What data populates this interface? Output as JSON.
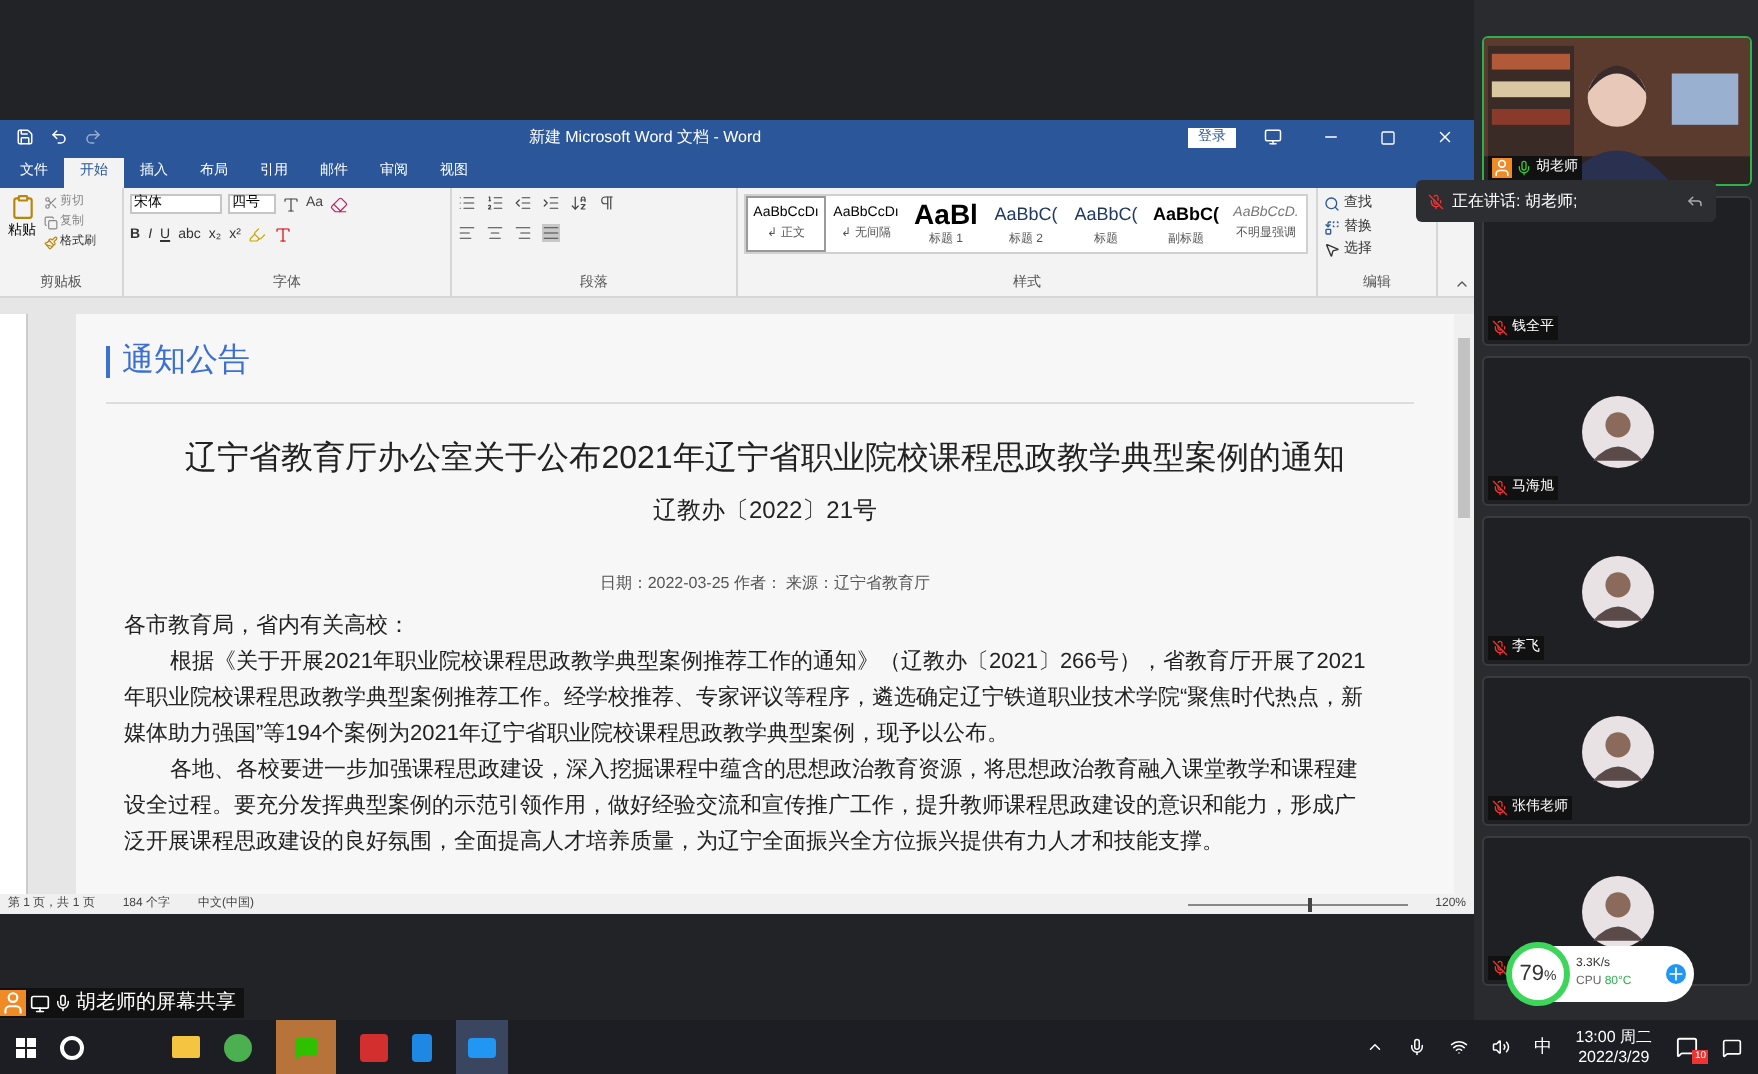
{
  "word": {
    "title": "新建 Microsoft Word 文档 - Word",
    "login": "登录",
    "tabs": [
      {
        "label": "文件",
        "selected": false
      },
      {
        "label": "开始",
        "selected": true
      },
      {
        "label": "插入",
        "selected": false
      },
      {
        "label": "布局",
        "selected": false
      },
      {
        "label": "引用",
        "selected": false
      },
      {
        "label": "邮件",
        "selected": false
      },
      {
        "label": "审阅",
        "selected": false
      },
      {
        "label": "视图",
        "selected": false
      }
    ],
    "clipboard": {
      "paste": "粘贴",
      "cut": "剪切",
      "copy": "复制",
      "format_painter": "格式刷",
      "label": "剪贴板"
    },
    "font": {
      "name": "宋体",
      "size": "四号",
      "change_case": "Aa",
      "buttons": [
        "B",
        "I",
        "U",
        "abc",
        "x₂",
        "x²"
      ],
      "label": "字体"
    },
    "paragraph": {
      "label": "段落"
    },
    "styles": {
      "label": "样式",
      "items": [
        {
          "preview": "AaBbCcDı",
          "name": "↲ 正文",
          "kind": "normal",
          "selected": true
        },
        {
          "preview": "AaBbCcDı",
          "name": "↲ 无间隔",
          "kind": "normal",
          "selected": false
        },
        {
          "preview": "AaBl",
          "name": "标题 1",
          "kind": "heading",
          "selected": false
        },
        {
          "preview": "AaBbC(",
          "name": "标题 2",
          "kind": "subheading",
          "selected": false
        },
        {
          "preview": "AaBbC(",
          "name": "标题",
          "kind": "subheading",
          "selected": false
        },
        {
          "preview": "AaBbC(",
          "name": "副标题",
          "kind": "bold",
          "selected": false
        },
        {
          "preview": "AaBbCcD.",
          "name": "不明显强调",
          "kind": "emphasis",
          "selected": false
        }
      ]
    },
    "editing": {
      "label": "编辑",
      "find": "查找",
      "replace": "替换",
      "select": "选择"
    },
    "document": {
      "section": "通知公告",
      "title": "辽宁省教育厅办公室关于公布2021年辽宁省职业院校课程思政教学典型案例的通知",
      "number": "辽教办〔2022〕21号",
      "meta": "日期：2022-03-25 作者： 来源：辽宁省教育厅",
      "greeting": "各市教育局，省内有关高校：",
      "paragraphs": [
        "根据《关于开展2021年职业院校课程思政教学典型案例推荐工作的通知》（辽教办〔2021〕266号），省教育厅开展了2021年职业院校课程思政教学典型案例推荐工作。经学校推荐、专家评议等程序，遴选确定辽宁铁道职业技术学院“聚焦时代热点，新媒体助力强国”等194个案例为2021年辽宁省职业院校课程思政教学典型案例，现予以公布。",
        "各地、各校要进一步加强课程思政建设，深入挖掘课程中蕴含的思想政治教育资源，将思想政治教育融入课堂教学和课程建设全过程。要充分发挥典型案例的示范引领作用，做好经验交流和宣传推广工作，提升教师课程思政建设的意识和能力，形成广泛开展课程思政建设的良好氛围，全面提高人才培养质量，为辽宁全面振兴全方位振兴提供有力人才和技能支撑。"
      ]
    },
    "status_bar": {
      "page": "第 1 页，共 1 页",
      "words": "184 个字",
      "language": "中文(中国)",
      "zoom": "120%",
      "zoom_level": {
        "level": 0.55
      }
    }
  },
  "share_label": "胡老师的屏幕共享",
  "speaking": "正在讲话: 胡老师;",
  "participants": [
    {
      "name": "胡老师",
      "kind": "video",
      "muted": false
    },
    {
      "name": "钱全平",
      "kind": "empty",
      "muted": true
    },
    {
      "name": "马海旭",
      "kind": "avatar",
      "muted": true
    },
    {
      "name": "李飞",
      "kind": "avatar",
      "muted": true
    },
    {
      "name": "张伟老师",
      "kind": "avatar",
      "muted": true
    },
    {
      "kind": "avatar",
      "muted": true
    }
  ],
  "monitor": {
    "percent": "79",
    "unit": "%",
    "speed": "3.3K/s",
    "cpu_label": "CPU",
    "cpu_temp": "80°C"
  },
  "taskbar": {
    "ime": "中",
    "time": "13:00 周二",
    "date": "2022/3/29",
    "notifications": "10"
  }
}
